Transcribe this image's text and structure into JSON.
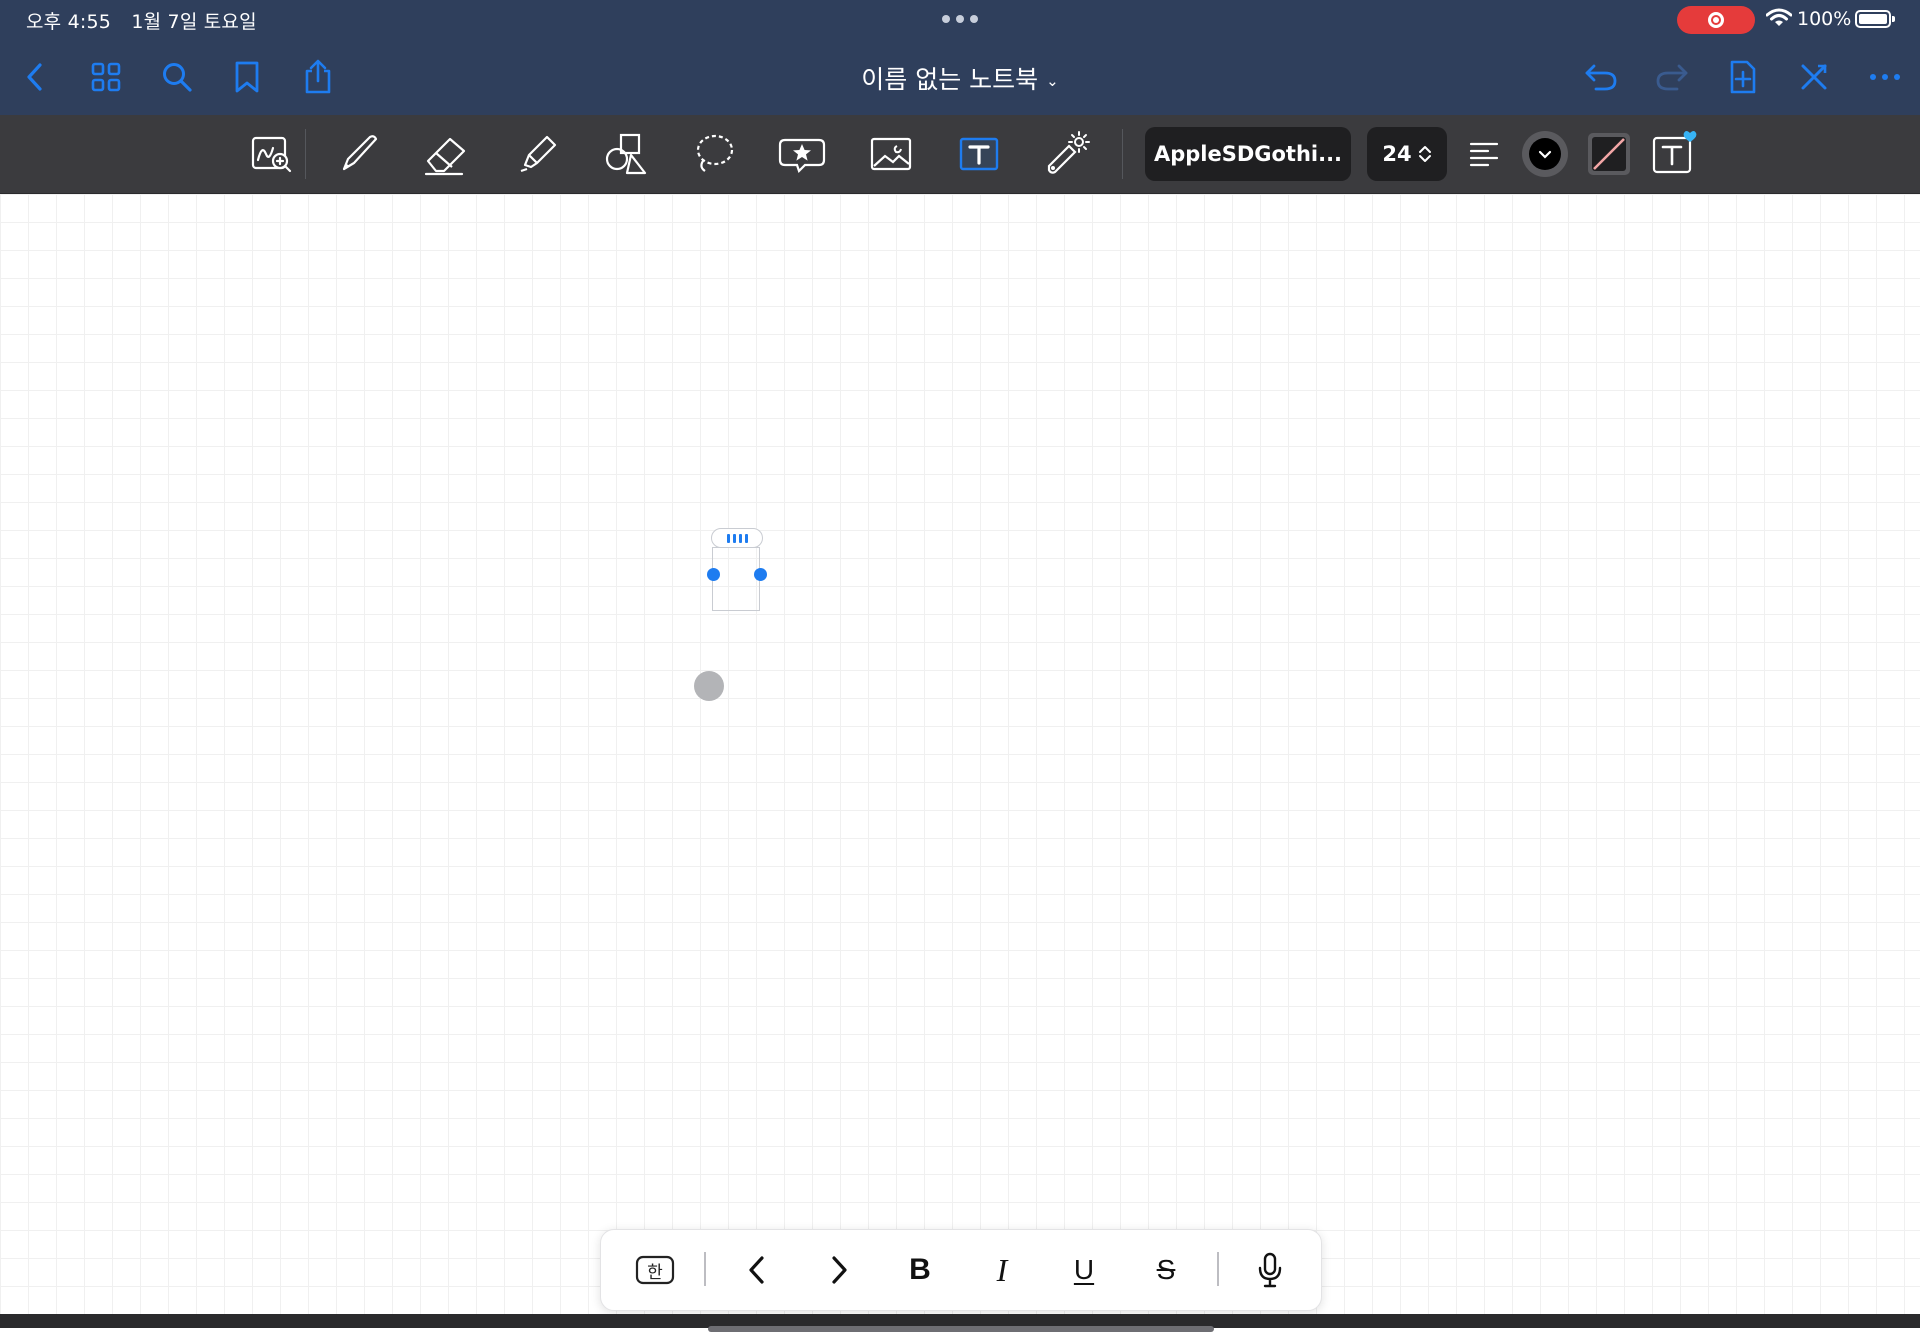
{
  "status": {
    "time": "오후 4:55",
    "date": "1월 7일 토요일",
    "battery": "100%"
  },
  "nav": {
    "title": "이름 없는 노트북",
    "title_chevron": "⌄",
    "left_icons": [
      "back-chevron-icon",
      "grid-icon",
      "search-icon",
      "bookmark-icon",
      "share-icon"
    ],
    "right_icons": [
      "undo-icon",
      "redo-icon",
      "add-page-icon",
      "close-edit-icon",
      "more-icon"
    ]
  },
  "toolbar": {
    "tools": [
      "zoom-handwriting-icon",
      "pen-icon",
      "eraser-icon",
      "highlighter-icon",
      "shapes-icon",
      "lasso-icon",
      "sticker-icon",
      "image-icon",
      "text-tool-icon",
      "laser-pointer-icon"
    ],
    "selected_tool": "text-tool-icon",
    "font_name": "AppleSDGothi...",
    "font_size": "24",
    "color": "#000000"
  },
  "format_bar": {
    "keyboard_label": "한",
    "bold": "B",
    "italic": "I",
    "underline": "U",
    "strike": "S"
  },
  "colors": {
    "nav_bg": "#2f3f5c",
    "toolbar_bg": "#3b3b3e",
    "accent": "#1e7cf0",
    "record": "#e53b3b"
  }
}
